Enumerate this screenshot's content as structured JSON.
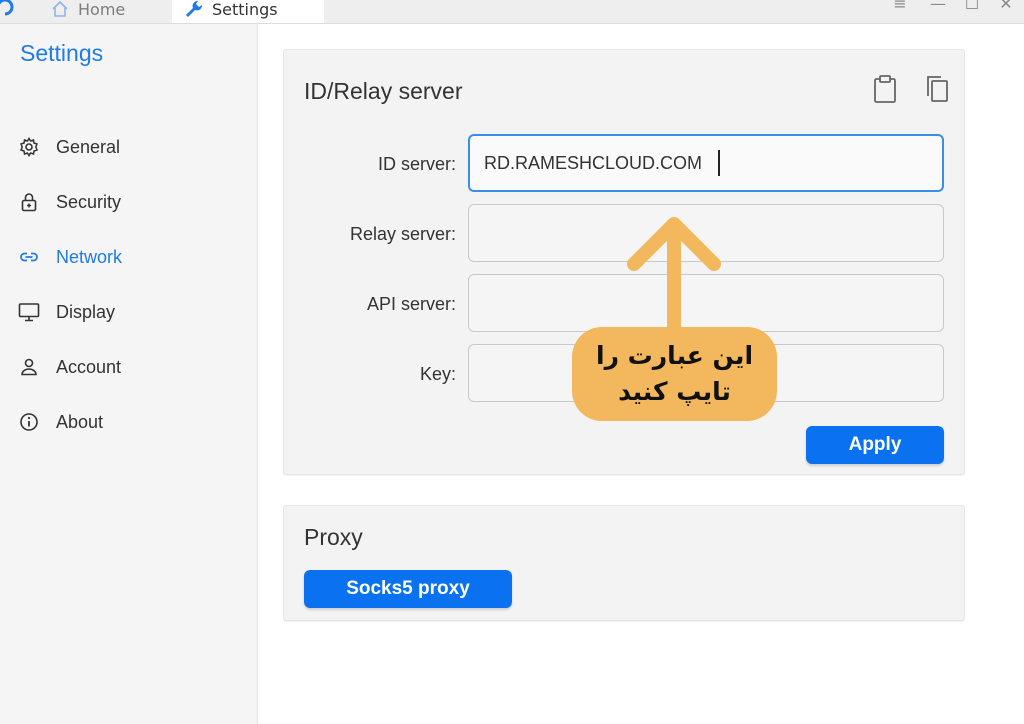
{
  "titlebar": {
    "tabs": [
      {
        "label": "Home",
        "icon": "home-icon"
      },
      {
        "label": "Settings",
        "icon": "wrench-icon"
      }
    ],
    "controls": [
      "menu-icon",
      "minimize-icon",
      "maximize-icon",
      "close-icon"
    ],
    "menu_glyph": "≡",
    "minimize_glyph": "—",
    "maximize_glyph": "☐",
    "close_glyph": "✕"
  },
  "sidebar": {
    "title": "Settings",
    "items": [
      {
        "label": "General",
        "icon": "gear-icon"
      },
      {
        "label": "Security",
        "icon": "lock-icon"
      },
      {
        "label": "Network",
        "icon": "link-icon",
        "active": true
      },
      {
        "label": "Display",
        "icon": "monitor-icon"
      },
      {
        "label": "Account",
        "icon": "user-icon"
      },
      {
        "label": "About",
        "icon": "info-icon"
      }
    ]
  },
  "id_relay": {
    "title": "ID/Relay server",
    "fields": [
      {
        "label": "ID server:",
        "value": "RD.RAMESHCLOUD.COM"
      },
      {
        "label": "Relay server:",
        "value": ""
      },
      {
        "label": "API server:",
        "value": ""
      },
      {
        "label": "Key:",
        "value": ""
      }
    ],
    "apply_label": "Apply"
  },
  "proxy": {
    "title": "Proxy",
    "socks_label": "Socks5 proxy"
  },
  "annotation": {
    "line1": "این عبارت را",
    "line2": "تایپ کنید"
  },
  "colors": {
    "accent": "#1e7be8",
    "button": "#0a72f0",
    "annotation": "#f3b85d"
  }
}
